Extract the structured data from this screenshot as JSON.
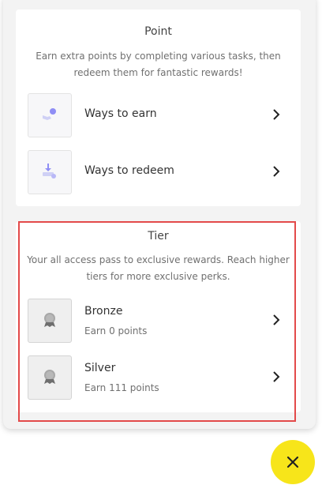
{
  "point": {
    "title": "Point",
    "description": "Earn extra points by completing various tasks, then redeem them for fantastic rewards!",
    "items": [
      {
        "label": "Ways to earn",
        "icon": "earn-icon"
      },
      {
        "label": "Ways to redeem",
        "icon": "redeem-icon"
      }
    ]
  },
  "tier": {
    "title": "Tier",
    "description": "Your all access pass to exclusive rewards. Reach higher tiers for more exclusive perks.",
    "items": [
      {
        "label": "Bronze",
        "sublabel": "Earn 0 points",
        "icon": "badge-icon"
      },
      {
        "label": "Silver",
        "sublabel": "Earn 111 points",
        "icon": "badge-icon"
      }
    ]
  },
  "close_button": {
    "icon": "close-icon"
  },
  "colors": {
    "accent_fab": "#f7e51a",
    "highlight_border": "#e34a4a",
    "icon_purple": "#8f8ef5"
  }
}
